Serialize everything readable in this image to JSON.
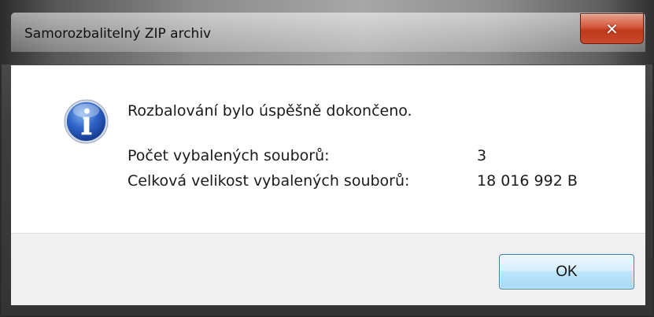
{
  "window": {
    "title": "Samorozbalitelný ZIP archiv",
    "close_glyph": "✕"
  },
  "dialog": {
    "icon": "info-icon",
    "message": "Rozbalování bylo úspěšně dokončeno.",
    "stats": [
      {
        "label": "Počet vybalených souborů:",
        "value": "3"
      },
      {
        "label": "Celková velikost vybalených souborů:",
        "value": "18 016 992 B"
      }
    ]
  },
  "buttons": {
    "ok_label": "OK"
  },
  "colors": {
    "close_button": "#c94a2c",
    "ok_button_border": "#3c7fb1",
    "info_icon_blue": "#2d63c8"
  }
}
